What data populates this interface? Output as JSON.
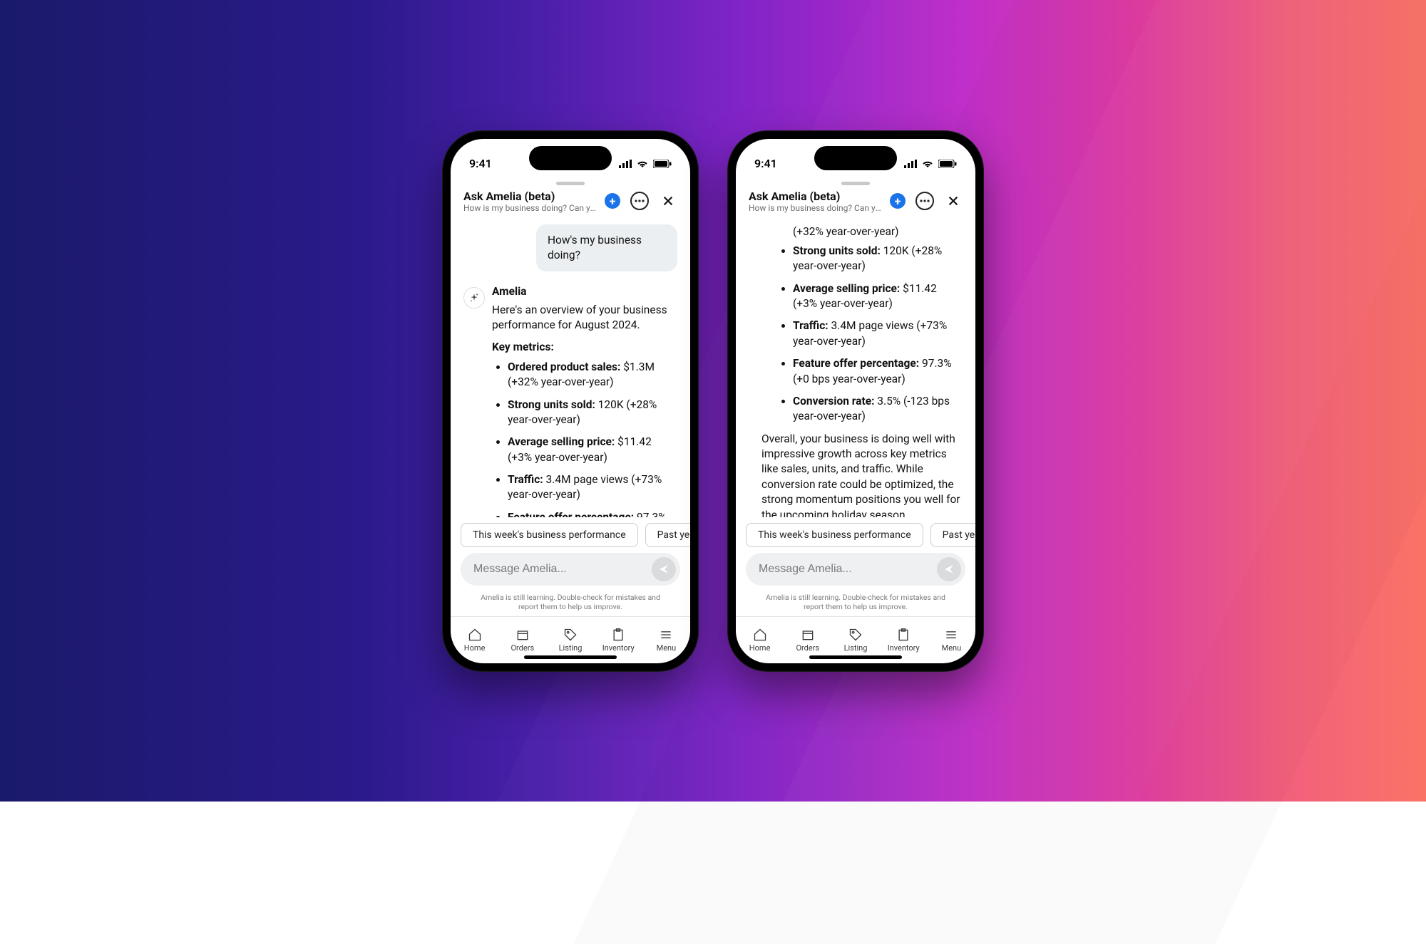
{
  "status": {
    "time": "9:41"
  },
  "header": {
    "title": "Ask Amelia (beta)",
    "subtitle": "How is my business doing? Can you…"
  },
  "user_message": "How's my business doing?",
  "assistant": {
    "name": "Amelia",
    "intro": "Here's an overview of your business performance for August 2024.",
    "key_metrics_label": "Key metrics:",
    "metrics": [
      {
        "label": "Ordered product sales:",
        "value": "$1.3M (+32% year-over-year)"
      },
      {
        "label": "Strong units sold:",
        "value": "120K (+28% year-over-year)"
      },
      {
        "label": "Average selling price:",
        "value": "$11.42 (+3% year-over-year)"
      },
      {
        "label": "Traffic:",
        "value": "3.4M page views (+73% year-over-year)"
      },
      {
        "label": "Feature offer percentage:",
        "value": "97.3% (+0 bps year-over-year)"
      },
      {
        "label": "Conversion rate:",
        "value": "3.5% (-123 bps year-over-year)"
      }
    ],
    "overall": "Overall, your business is doing well with impressive growth across key metrics like sales, units, and traffic. While conversion rate could be optimized, the strong momentum positions you well for the upcoming holiday season."
  },
  "phone2_partial": "(+32% year-over-year)",
  "suggestions": [
    "This week's business performance",
    "Past year's bu"
  ],
  "composer": {
    "placeholder": "Message Amelia..."
  },
  "disclaimer": "Amelia is still learning. Double-check for mistakes and report them to help us improve.",
  "tabs": [
    "Home",
    "Orders",
    "Listing",
    "Inventory",
    "Menu"
  ]
}
